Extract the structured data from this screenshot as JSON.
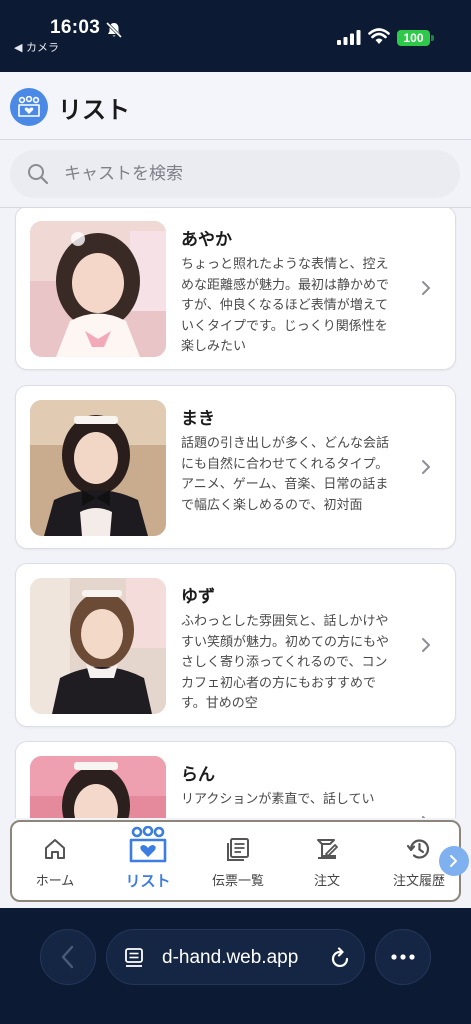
{
  "status_bar": {
    "time": "16:03",
    "back_app": "◀ カメラ",
    "battery": "100"
  },
  "header": {
    "title": "リスト",
    "logo_icon": "cast-heart-icon"
  },
  "search": {
    "placeholder": "キャストを検索",
    "value": ""
  },
  "casts": [
    {
      "name": "あやか",
      "description": "ちょっと照れたような表情と、控えめな距離感が魅力。最初は静かめですが、仲良くなるほど表情が増えていくタイプです。じっくり関係性を楽しみたい"
    },
    {
      "name": "まき",
      "description": "話題の引き出しが多く、どんな会話にも自然に合わせてくれるタイプ。アニメ、ゲーム、音楽、日常の話まで幅広く楽しめるので、初対面"
    },
    {
      "name": "ゆず",
      "description": "ふわっとした雰囲気と、話しかけやすい笑顔が魅力。初めての方にもやさしく寄り添ってくれるので、コンカフェ初心者の方にもおすすめです。甘めの空"
    },
    {
      "name": "らん",
      "description": "リアクションが素直で、話してい"
    }
  ],
  "nav": {
    "items": [
      {
        "label": "ホーム",
        "icon": "home-icon"
      },
      {
        "label": "リスト",
        "icon": "cast-heart-icon"
      },
      {
        "label": "伝票一覧",
        "icon": "receipts-icon"
      },
      {
        "label": "注文",
        "icon": "order-icon"
      },
      {
        "label": "注文履歴",
        "icon": "history-icon"
      }
    ],
    "active": "リスト"
  },
  "browser": {
    "url": "d-hand.web.app"
  },
  "colors": {
    "accent": "#3b7de0",
    "status_bar": "#0c1a33",
    "battery": "#2ec84a"
  }
}
